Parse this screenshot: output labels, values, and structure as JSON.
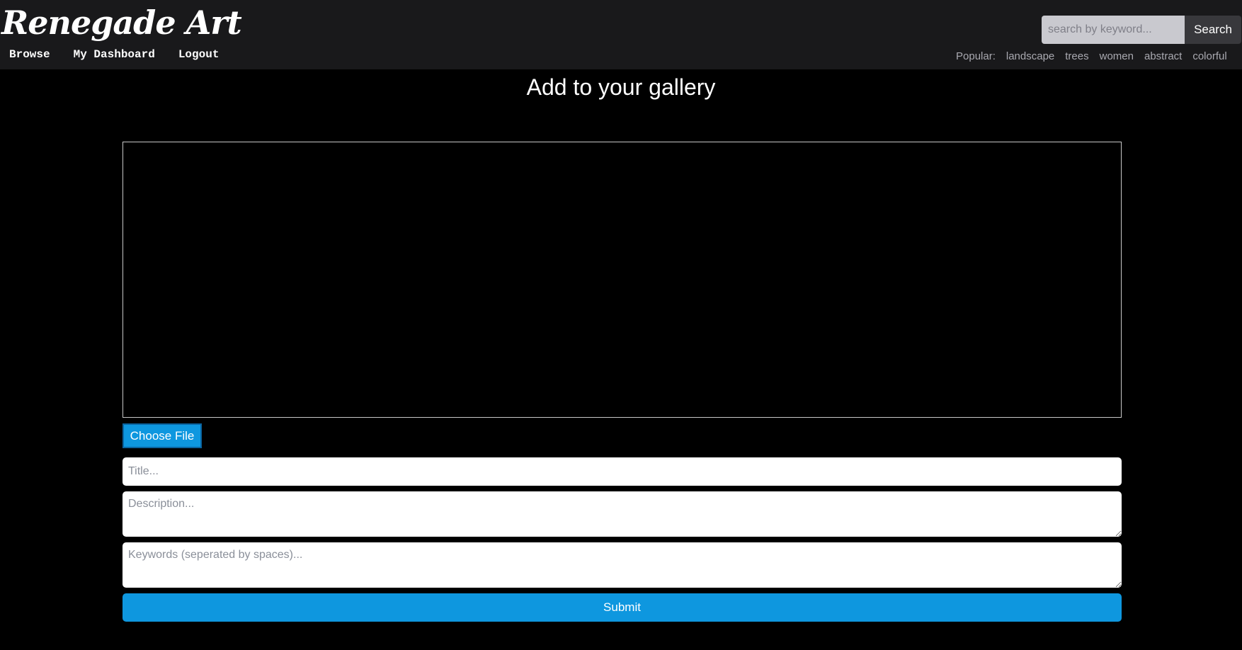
{
  "header": {
    "logo": "Renegade Art",
    "nav": [
      "Browse",
      "My Dashboard",
      "Logout"
    ],
    "search": {
      "placeholder": "search by keyword...",
      "value": "",
      "button_label": "Search"
    },
    "popular": {
      "label": "Popular:",
      "tags": [
        "landscape",
        "trees",
        "women",
        "abstract",
        "colorful"
      ]
    }
  },
  "main": {
    "title": "Add to your gallery",
    "choose_file_label": "Choose File",
    "fields": {
      "title_placeholder": "Title...",
      "description_placeholder": "Description...",
      "keywords_placeholder": "Keywords (seperated by spaces)..."
    },
    "submit_label": "Submit"
  },
  "colors": {
    "header_bg": "#19191b",
    "page_bg": "#000000",
    "accent": "#0e97df",
    "text": "#ffffff"
  }
}
